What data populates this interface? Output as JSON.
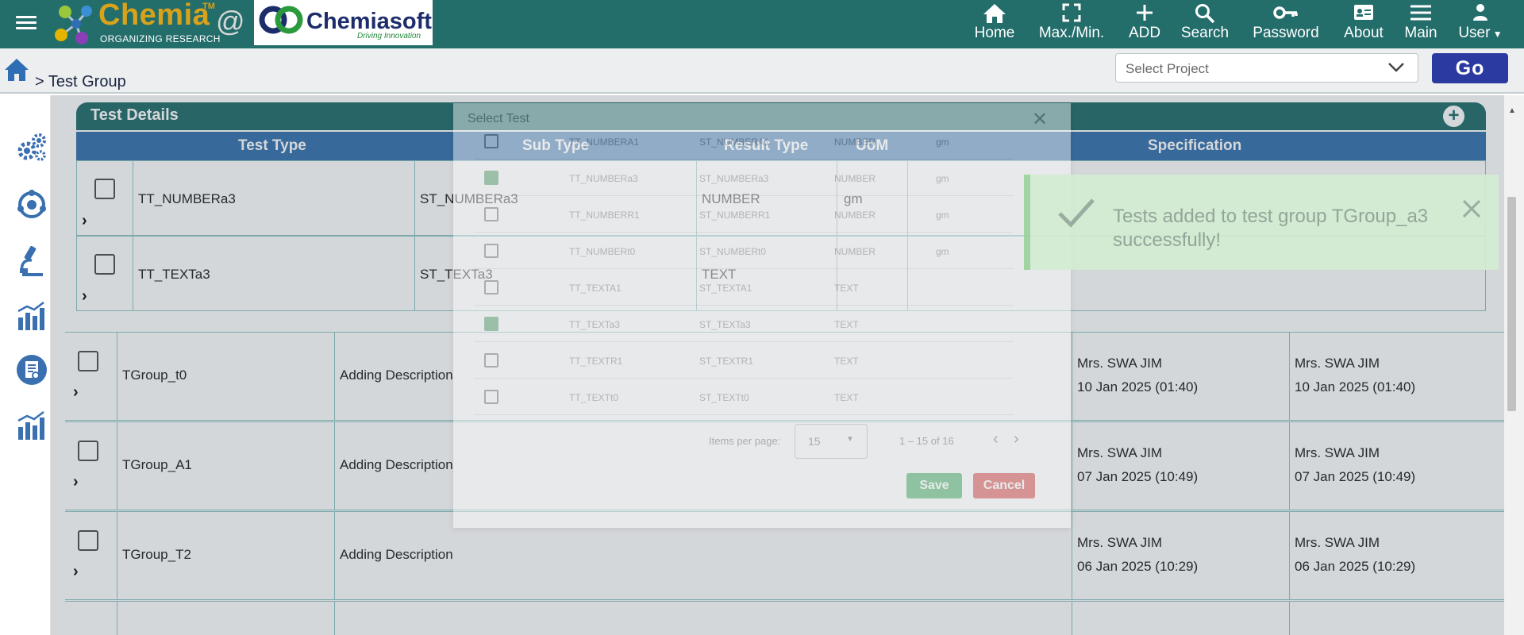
{
  "header": {
    "brand_name": "Chemia",
    "brand_tm": "TM",
    "brand_tagline": "ORGANIZING RESEARCH",
    "at_symbol": "@",
    "partner_name": "Chemiasoft",
    "partner_tagline": "Driving Innovation",
    "nav": [
      {
        "label": "Home",
        "icon": "home-icon"
      },
      {
        "label": "Max./Min.",
        "icon": "fullscreen-icon"
      },
      {
        "label": "ADD",
        "icon": "plus-icon"
      },
      {
        "label": "Search",
        "icon": "search-icon"
      },
      {
        "label": "Password",
        "icon": "key-icon"
      },
      {
        "label": "About",
        "icon": "id-card-icon"
      },
      {
        "label": "Main",
        "icon": "menu-icon"
      },
      {
        "label": "User",
        "icon": "user-icon"
      }
    ]
  },
  "breadcrumb": {
    "text": "> Test Group"
  },
  "project_select": {
    "placeholder": "Select Project"
  },
  "go_button": {
    "label": "Go"
  },
  "sidebar": {
    "icons": [
      "gears-icon",
      "settings-cycle-icon",
      "microscope-icon",
      "bar-chart-icon",
      "report-icon",
      "analytics-icon"
    ]
  },
  "test_details": {
    "title": "Test Details",
    "columns": [
      "Test Type",
      "Sub Type",
      "Result Type",
      "UoM",
      "Specification"
    ],
    "rows": [
      {
        "test_type": "TT_NUMBERa3",
        "sub_type": "ST_NUMBERa3",
        "result_type": "NUMBER",
        "uom": "gm",
        "specification": ""
      },
      {
        "test_type": "TT_TEXTa3",
        "sub_type": "ST_TEXTa3",
        "result_type": "TEXT",
        "uom": "",
        "specification": ""
      }
    ]
  },
  "groups": [
    {
      "name": "TGroup_t0",
      "description": "Adding Description",
      "created_by": "Mrs. SWA JIM",
      "created_on": "10 Jan 2025 (01:40)",
      "modified_by": "Mrs. SWA JIM",
      "modified_on": "10 Jan 2025 (01:40)"
    },
    {
      "name": "TGroup_A1",
      "description": "Adding Description",
      "created_by": "Mrs. SWA JIM",
      "created_on": "07 Jan 2025 (10:49)",
      "modified_by": "Mrs. SWA JIM",
      "modified_on": "07 Jan 2025 (10:49)"
    },
    {
      "name": "TGroup_T2",
      "description": "Adding Description",
      "created_by": "Mrs. SWA JIM",
      "created_on": "06 Jan 2025 (10:29)",
      "modified_by": "Mrs. SWA JIM",
      "modified_on": "06 Jan 2025 (10:29)"
    }
  ],
  "dialog": {
    "title": "Select Test",
    "rows": [
      {
        "test_type": "TT_NUMBERA1",
        "sub_type": "ST_NUMBERA1",
        "result_type": "NUMBER",
        "uom": "gm",
        "checked": false
      },
      {
        "test_type": "TT_NUMBERa3",
        "sub_type": "ST_NUMBERa3",
        "result_type": "NUMBER",
        "uom": "gm",
        "checked": true
      },
      {
        "test_type": "TT_NUMBERR1",
        "sub_type": "ST_NUMBERR1",
        "result_type": "NUMBER",
        "uom": "gm",
        "checked": false
      },
      {
        "test_type": "TT_NUMBERt0",
        "sub_type": "ST_NUMBERt0",
        "result_type": "NUMBER",
        "uom": "gm",
        "checked": false
      },
      {
        "test_type": "TT_TEXTA1",
        "sub_type": "ST_TEXTA1",
        "result_type": "TEXT",
        "uom": "",
        "checked": false
      },
      {
        "test_type": "TT_TEXTa3",
        "sub_type": "ST_TEXTa3",
        "result_type": "TEXT",
        "uom": "",
        "checked": true
      },
      {
        "test_type": "TT_TEXTR1",
        "sub_type": "ST_TEXTR1",
        "result_type": "TEXT",
        "uom": "",
        "checked": false
      },
      {
        "test_type": "TT_TEXTt0",
        "sub_type": "ST_TEXTt0",
        "result_type": "TEXT",
        "uom": "",
        "checked": false
      }
    ],
    "items_per_page_label": "Items per page:",
    "items_per_page_value": "15",
    "range_label": "1 – 15 of 16",
    "save_label": "Save",
    "cancel_label": "Cancel"
  },
  "toast": {
    "message": "Tests added to test group TGroup_a3 successfully!"
  },
  "colors": {
    "header_teal": "#236d6b",
    "column_blue": "#3672ae",
    "go_button": "#2b3aa0",
    "brand_gold": "#d9a21b",
    "toast_green": "#d3ecd3"
  }
}
